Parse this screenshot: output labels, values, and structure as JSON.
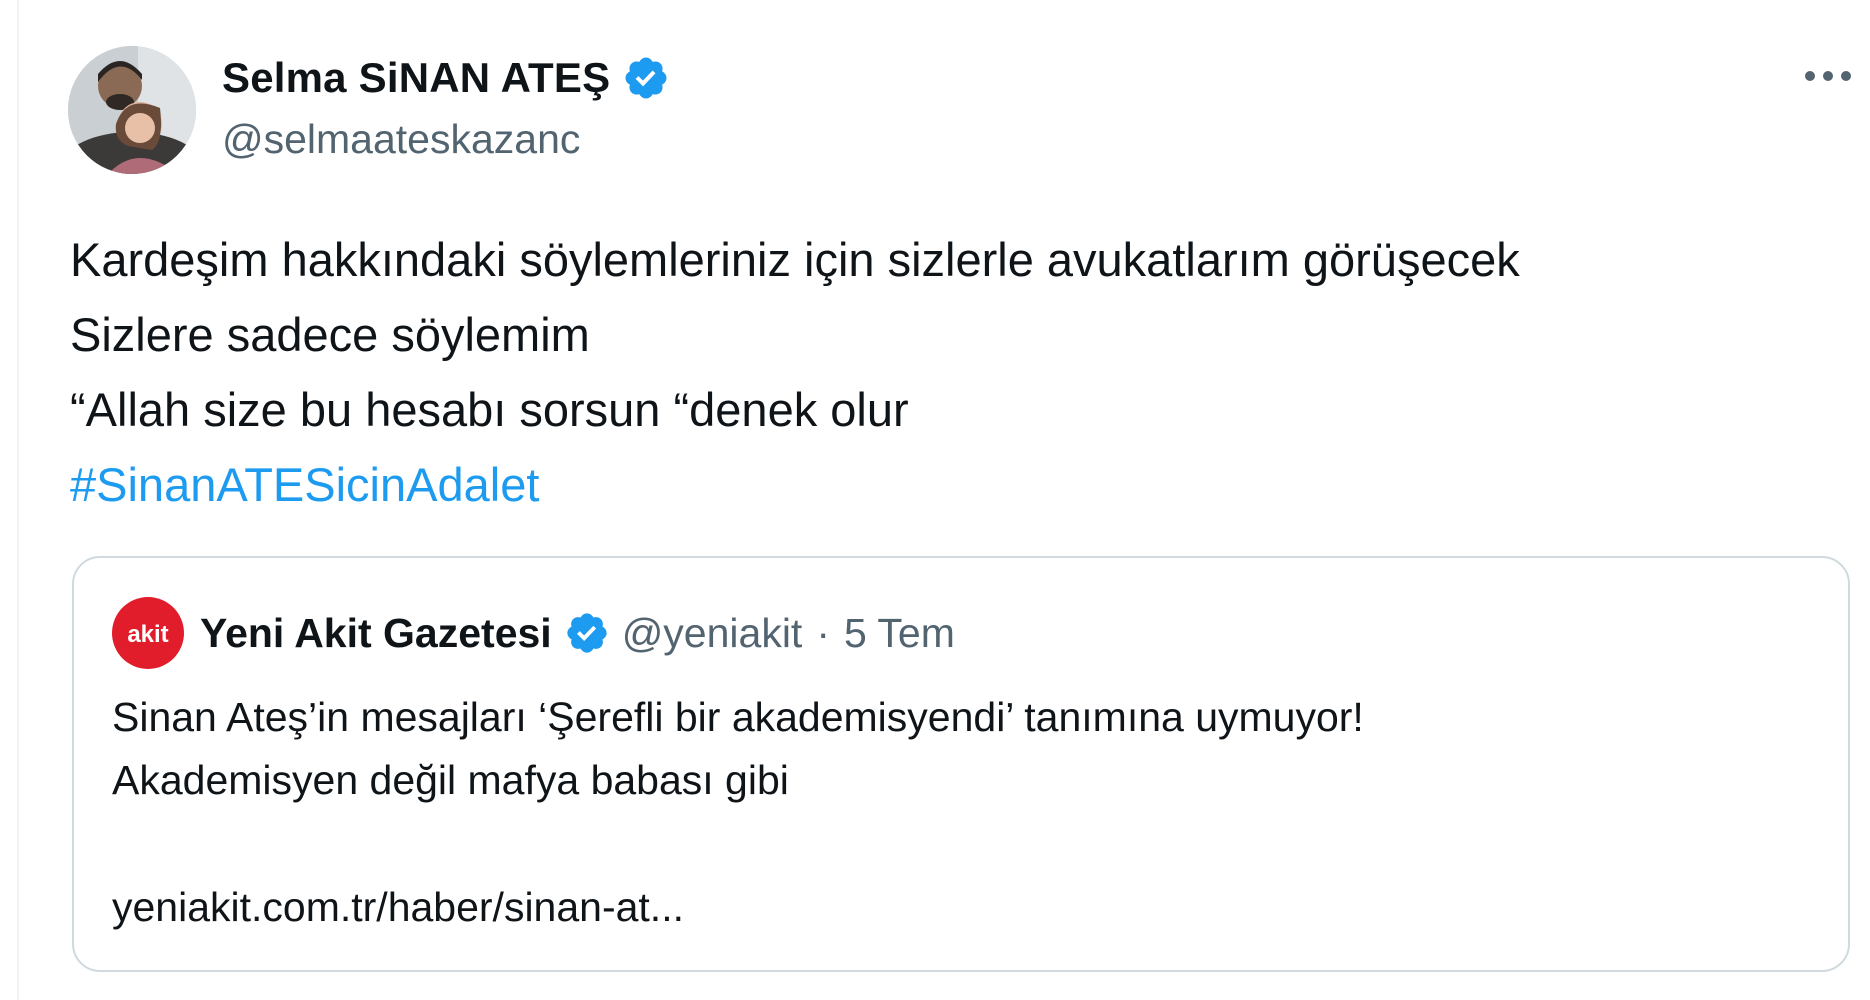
{
  "author": {
    "name": "Selma SiNAN ATEŞ",
    "handle": "@selmaateskazanc",
    "avatar_icon": "profile-photo"
  },
  "menu_icon": "more-horizontal-icon",
  "tweet": {
    "lines": [
      "Kardeşim hakkındaki söylemleriniz için sizlerle avukatlarım görüşecek",
      "Sizlere sadece söylemim",
      "“Allah size bu hesabı sorsun “denek olur"
    ],
    "hashtag": "#SinanATESicinAdalet"
  },
  "quoted": {
    "logo_text": "akit",
    "name": "Yeni Akit Gazetesi",
    "handle": "@yeniakit",
    "separator": "·",
    "time": "5 Tem",
    "lines": [
      "Sinan Ateş’in mesajları ‘Şerefli bir akademisyendi’ tanımına uymuyor!",
      "Akademisyen değil mafya babası gibi"
    ],
    "link": "yeniakit.com.tr/haber/sinan-at..."
  },
  "colors": {
    "link": "#1d9bf0",
    "verified": "#1d9bf0",
    "secondary_text": "#536471",
    "border": "#cfd9de",
    "akit_red": "#e11d2b"
  }
}
